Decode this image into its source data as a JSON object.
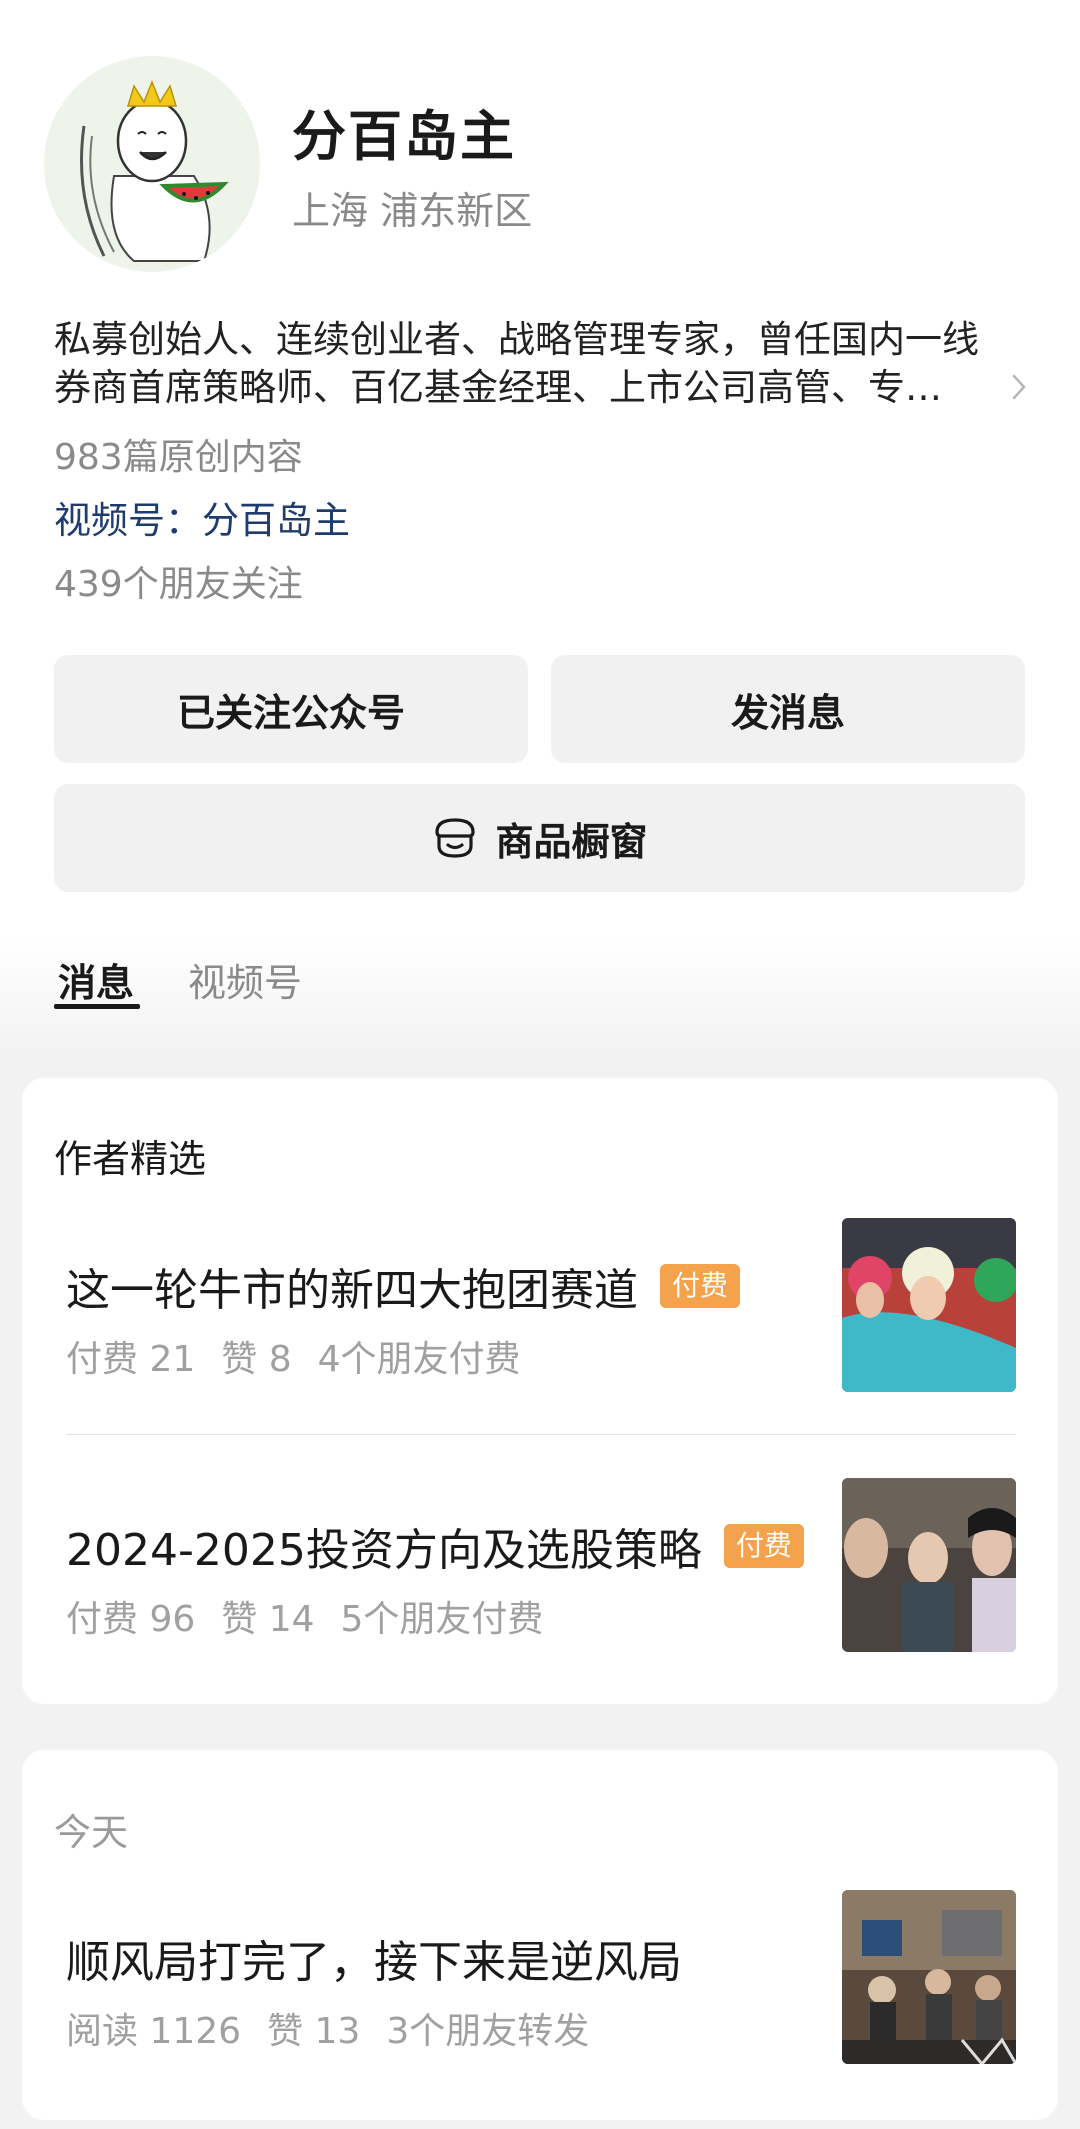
{
  "profile": {
    "name": "分百岛主",
    "location": "上海 浦东新区",
    "bio": "私募创始人、连续创业者、战略管理专家，曾任国内一线券商首席策略师、百亿基金经理、上市公司高管、专…",
    "original_count": "983篇原创内容",
    "channel_label": "视频号：",
    "channel_name": "分百岛主",
    "friends_following": "439个朋友关注"
  },
  "actions": {
    "follow_label": "已关注公众号",
    "message_label": "发消息",
    "shop_label": "商品橱窗"
  },
  "tabs": [
    {
      "label": "消息",
      "active": true
    },
    {
      "label": "视频号",
      "active": false
    }
  ],
  "featured": {
    "title": "作者精选",
    "articles": [
      {
        "title": "这一轮牛市的新四大抱团赛道",
        "badge": "付费",
        "stats": [
          "付费 21",
          "赞 8",
          "4个朋友付费"
        ]
      },
      {
        "title": "2024-2025投资方向及选股策略",
        "badge": "付费",
        "stats": [
          "付费 96",
          "赞 14",
          "5个朋友付费"
        ]
      }
    ]
  },
  "today": {
    "label": "今天",
    "articles": [
      {
        "title": "顺风局打完了，接下来是逆风局",
        "stats": [
          "阅读 1126",
          "赞 13",
          "3个朋友转发"
        ]
      }
    ]
  },
  "colors": {
    "badge": "#f4a24b",
    "channel_link": "#1f3c6e",
    "muted_text": "#8a8a8a",
    "button_bg": "#f1f1f1"
  },
  "icons": {
    "shop": "shop-icon",
    "chevron": "chevron-right-icon"
  }
}
